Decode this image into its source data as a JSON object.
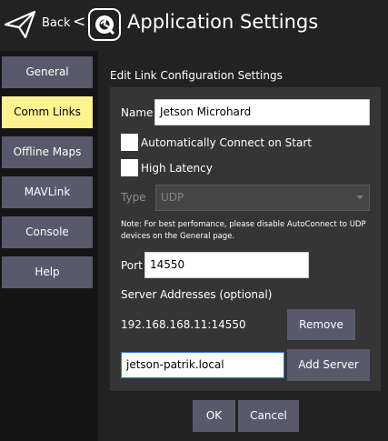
{
  "header": {
    "back_label": "Back",
    "back_chevron": "<",
    "title": "Application Settings",
    "back_icon": "paper-plane-icon",
    "logo_icon": "qgc-logo-icon"
  },
  "sidebar": {
    "active_color": "#fff291",
    "items": [
      {
        "label": "General"
      },
      {
        "label": "Comm Links"
      },
      {
        "label": "Offline Maps"
      },
      {
        "label": "MAVLink"
      },
      {
        "label": "Console"
      },
      {
        "label": "Help"
      }
    ]
  },
  "form": {
    "section_title": "Edit Link Configuration Settings",
    "name_label": "Name",
    "name_value": "Jetson Microhard",
    "auto_connect_label": "Automatically Connect on Start",
    "high_latency_label": "High Latency",
    "type_label": "Type",
    "type_value": "UDP",
    "note": "Note: For best perfomance, please disable AutoConnect to UDP devices on the General page.",
    "port_label": "Port",
    "port_value": "14550",
    "server_addresses_label": "Server Addresses (optional)",
    "server_address": "192.168.168.11:14550",
    "remove_label": "Remove",
    "new_server_value": "jetson-patrik.local",
    "add_server_label": "Add Server"
  },
  "footer": {
    "ok_label": "OK",
    "cancel_label": "Cancel"
  }
}
